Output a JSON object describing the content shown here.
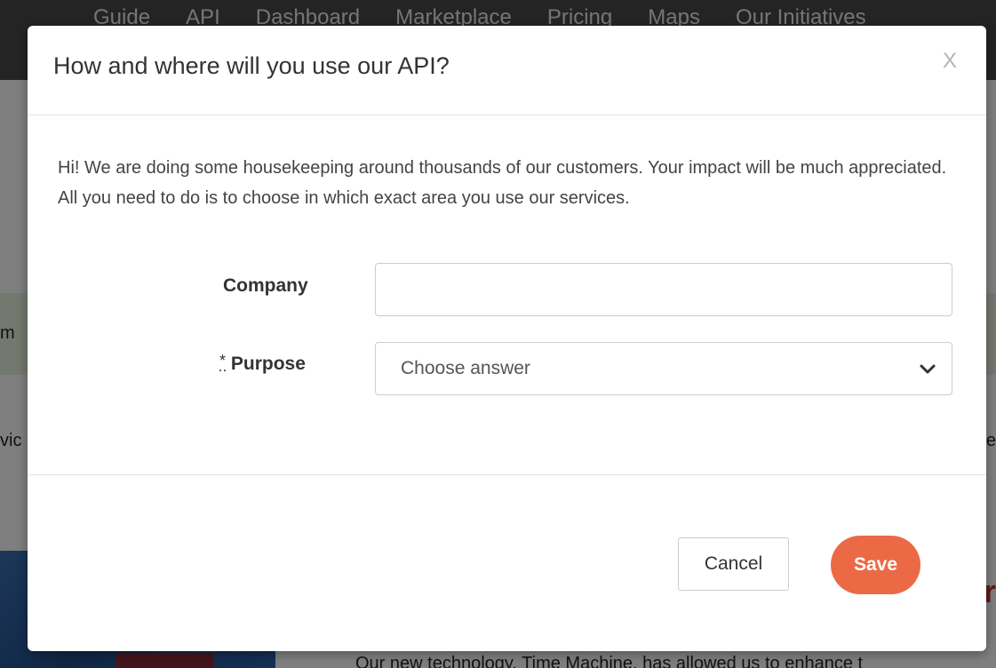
{
  "background": {
    "nav_items": [
      "Guide",
      "API",
      "Dashboard",
      "Marketplace",
      "Pricing",
      "Maps",
      "Our Initiatives"
    ],
    "banner_fragment": "m",
    "row_fragment_left": "vic",
    "row_fragment_right": "e",
    "heading_fragment": "r",
    "paragraph_fragment": "Our new technology, Time Machine, has allowed us to enhance t"
  },
  "modal": {
    "title": "How and where will you use our API?",
    "close_label": "X",
    "intro": "Hi! We are doing some housekeeping around thousands of our customers. Your impact will be much appreciated. All you need to do is to choose in which exact area you use our services.",
    "company": {
      "label": "Company",
      "value": "",
      "placeholder": ""
    },
    "purpose": {
      "required_mark": "*",
      "label": "Purpose",
      "selected": "Choose answer"
    },
    "footer": {
      "cancel_label": "Cancel",
      "save_label": "Save"
    }
  },
  "colors": {
    "save_button": "#eb6a45",
    "nav_background": "#48484a",
    "banner_background": "#e6f3df"
  },
  "icons": {
    "close": "x-icon",
    "select": "chevron-down-icon"
  }
}
